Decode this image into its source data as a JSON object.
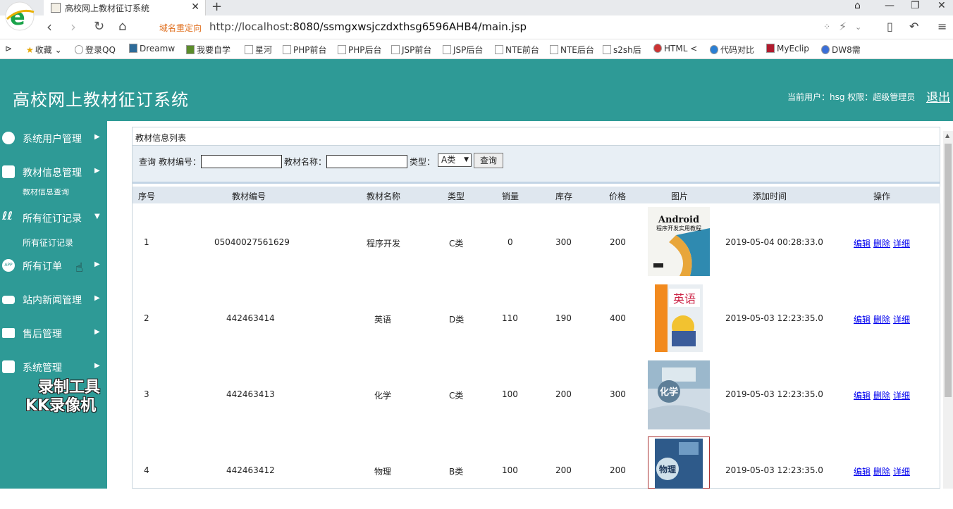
{
  "browser": {
    "tab_title": "高校网上教材征订系统",
    "redirect_label": "域名重定向",
    "url_host": "http://localhost",
    "url_rest": ":8080/ssmgxwsjczdxthsg6596AHB4/main.jsp",
    "bookmarks": [
      "收藏",
      "登录QQ",
      "Dreamw",
      "我要自学",
      "星河",
      "PHP前台",
      "PHP后台",
      "JSP前台",
      "JSP后台",
      "NTE前台",
      "NTE后台",
      "s2sh后",
      "HTML <",
      "代码对比",
      "MyEclip",
      "DW8需"
    ]
  },
  "header": {
    "title": "高校网上教材征订系统",
    "user_info": "当前用户：hsg 权限：超级管理员",
    "logout": "退出"
  },
  "sidebar": {
    "items": [
      {
        "label": "系统用户管理"
      },
      {
        "label": "教材信息管理"
      },
      {
        "label": "所有征订记录"
      },
      {
        "label": "所有订单"
      },
      {
        "label": "站内新闻管理"
      },
      {
        "label": "售后管理"
      },
      {
        "label": "系统管理"
      }
    ],
    "clipped_text": "教材信息查询",
    "submenu_label": "所有征订记录"
  },
  "watermark": {
    "line1": "录制工具",
    "line2": "KK录像机"
  },
  "panel": {
    "title": "教材信息列表",
    "search": {
      "prefix": "查询",
      "code_label": "教材编号：",
      "name_label": "教材名称：",
      "type_label": "类型：",
      "type_value": "A类",
      "button": "查询"
    },
    "columns": [
      "序号",
      "教材编号",
      "教材名称",
      "类型",
      "销量",
      "库存",
      "价格",
      "图片",
      "添加时间",
      "操作"
    ],
    "rows": [
      {
        "no": "1",
        "code": "05040027561629",
        "name": "程序开发",
        "type": "C类",
        "sales": "0",
        "stock": "300",
        "price": "200",
        "time": "2019-05-04 00:28:33.0",
        "cover_text": "Android",
        "cover_sub": "程序开发实用教程"
      },
      {
        "no": "2",
        "code": "442463414",
        "name": "英语",
        "type": "D类",
        "sales": "110",
        "stock": "190",
        "price": "400",
        "time": "2019-05-03 12:23:35.0",
        "cover_text": "英语"
      },
      {
        "no": "3",
        "code": "442463413",
        "name": "化学",
        "type": "C类",
        "sales": "100",
        "stock": "200",
        "price": "300",
        "time": "2019-05-03 12:23:35.0",
        "cover_text": "化学"
      },
      {
        "no": "4",
        "code": "442463412",
        "name": "物理",
        "type": "B类",
        "sales": "100",
        "stock": "200",
        "price": "200",
        "time": "2019-05-03 12:23:35.0",
        "cover_text": "物理"
      }
    ],
    "ops": {
      "edit": "编辑",
      "delete": "删除",
      "detail": "详细"
    }
  }
}
